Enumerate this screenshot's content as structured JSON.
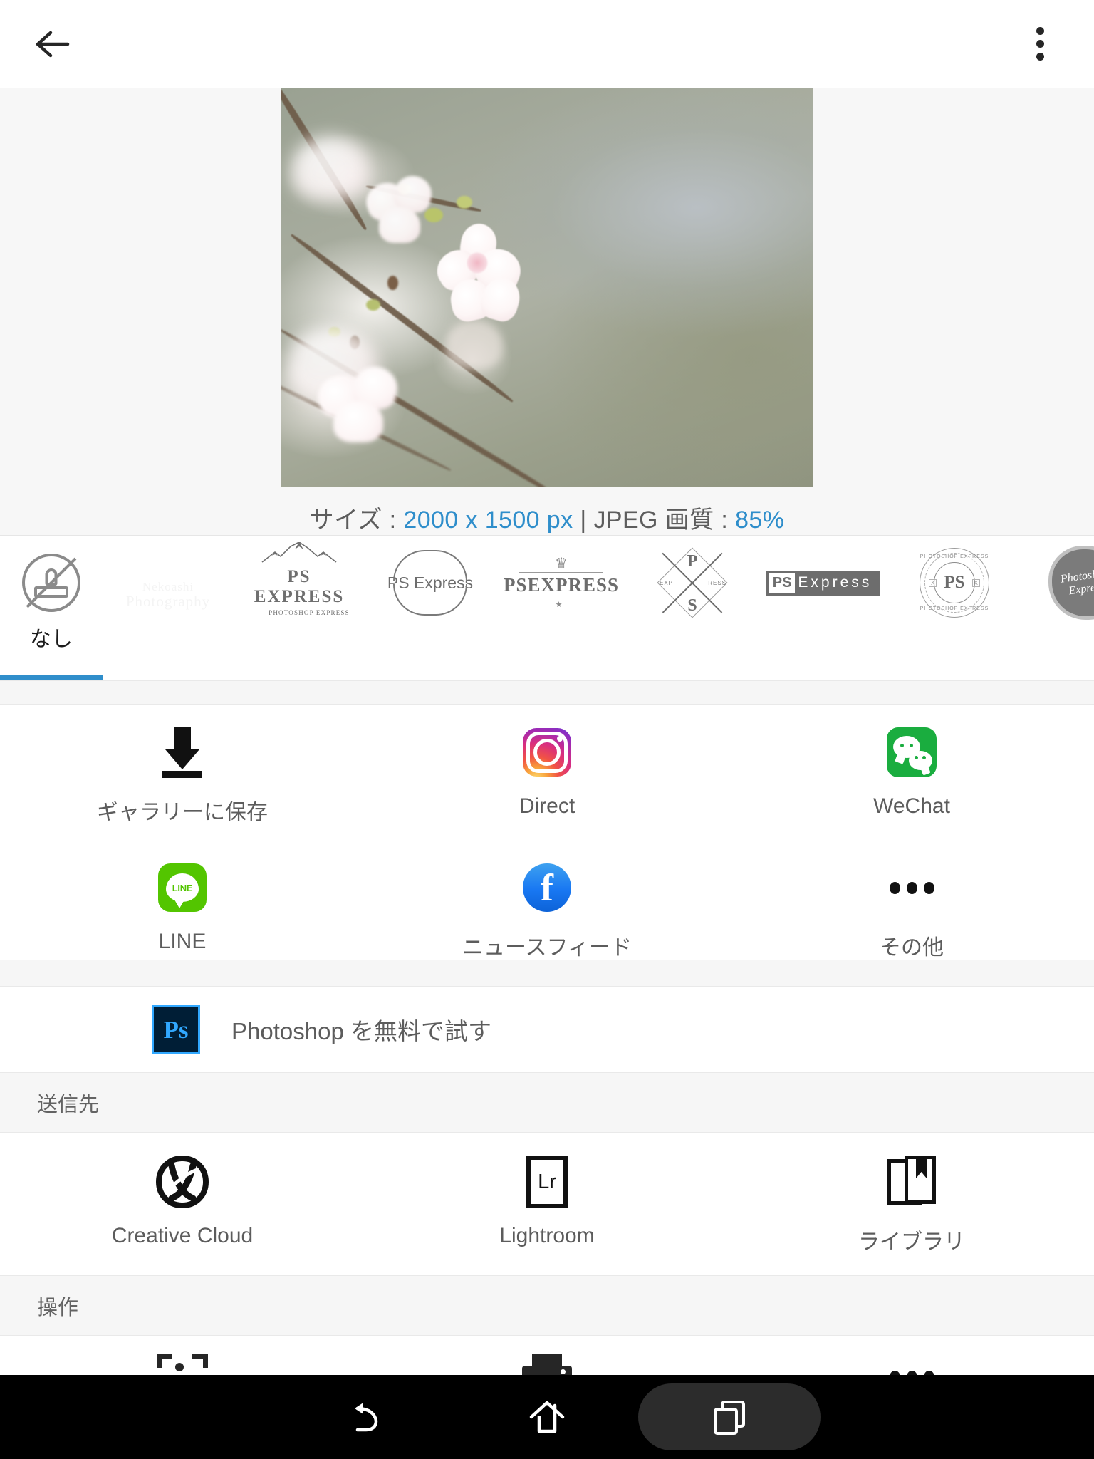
{
  "appbar": {
    "back_icon": "arrow-left-icon",
    "overflow_icon": "more-vertical-icon"
  },
  "preview": {
    "photo_alt": "cherry-blossom-photo",
    "size_label": "サイズ :",
    "size_value": "2000 x 1500 px",
    "divider": "|",
    "quality_label": "JPEG 画質 :",
    "quality_value": "85%",
    "accent_color": "#2f8ecb",
    "text_color": "#5d5d5d"
  },
  "watermarks": {
    "selected_index": 0,
    "items": [
      {
        "id": "none",
        "caption": "なし",
        "icon": "no-stamp-icon",
        "style": "none"
      },
      {
        "id": "nekoashi",
        "line1": "Nekoashi",
        "line2": "Photography",
        "style": "faint-script"
      },
      {
        "id": "ps-express-mountain",
        "title": "PS EXPRESS",
        "subtitle": "PHOTOSHOP EXPRESS",
        "style": "mountain"
      },
      {
        "id": "ps-express-arc",
        "title": "PS Express",
        "style": "arc"
      },
      {
        "id": "psexpress-crown",
        "title": "PSEXPRESS",
        "crown": "♛",
        "star": "★",
        "style": "crown-arch"
      },
      {
        "id": "ps-diamond",
        "letter_top": "P",
        "letter_bottom": "S",
        "left_word": "EXP",
        "right_word": "RESS",
        "style": "diamond-arrows"
      },
      {
        "id": "ps-express-box",
        "ps": "PS",
        "word": "Express",
        "style": "box"
      },
      {
        "id": "ps-seal",
        "center": "PS",
        "top_text": "PHOTOSHOP EXPRESS",
        "bottom_text": "PHOTOSHOP EXPRESS",
        "mark": "X",
        "style": "seal"
      },
      {
        "id": "photoshop-express-wax",
        "line1": "Photoshop",
        "line2": "Express",
        "style": "wax-stamp"
      }
    ]
  },
  "share": {
    "row1": [
      {
        "id": "save-to-gallery",
        "label": "ギャラリーに保存",
        "icon": "download-icon"
      },
      {
        "id": "instagram-direct",
        "label": "Direct",
        "icon": "instagram-icon"
      },
      {
        "id": "wechat",
        "label": "WeChat",
        "icon": "wechat-icon"
      }
    ],
    "row2": [
      {
        "id": "line",
        "label": "LINE",
        "icon": "line-icon"
      },
      {
        "id": "facebook-news-feed",
        "label": "ニュースフィード",
        "icon": "facebook-icon"
      },
      {
        "id": "more",
        "label": "その他",
        "icon": "more-horizontal-icon"
      }
    ]
  },
  "promo": {
    "label": "Photoshop を無料で試す",
    "badge_text": "Ps",
    "badge_bg": "#001e36",
    "badge_accent": "#31a8ff"
  },
  "send_to": {
    "header": "送信先",
    "items": [
      {
        "id": "creative-cloud",
        "label": "Creative Cloud",
        "icon": "creative-cloud-icon"
      },
      {
        "id": "lightroom",
        "label": "Lightroom",
        "icon": "lightroom-icon",
        "badge_text": "Lr"
      },
      {
        "id": "library",
        "label": "ライブラリ",
        "icon": "library-icon"
      }
    ]
  },
  "actions": {
    "header": "操作",
    "items": [
      {
        "id": "set-as-wallpaper",
        "icon": "wallpaper-icon"
      },
      {
        "id": "print",
        "icon": "printer-icon"
      },
      {
        "id": "more-actions",
        "icon": "more-horizontal-icon"
      }
    ]
  },
  "navbar": {
    "back": "nav-back-icon",
    "home": "nav-home-icon",
    "recents": "nav-recents-icon",
    "active": "recents"
  }
}
